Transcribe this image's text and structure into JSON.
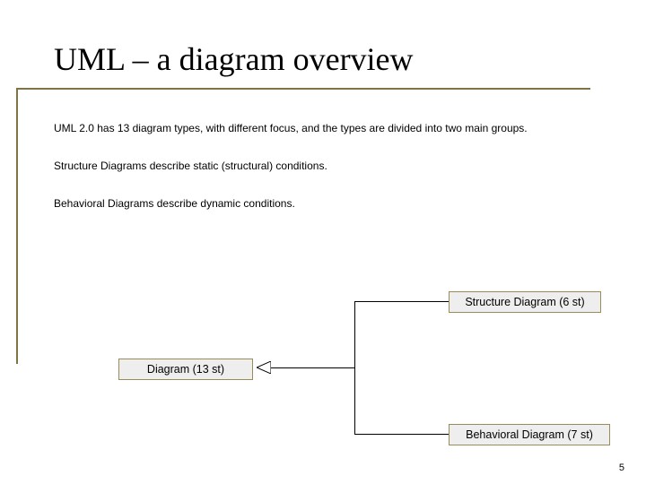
{
  "title": "UML – a diagram overview",
  "paragraphs": {
    "p1": "UML 2.0 has 13 diagram types, with different focus, and the types are divided into two main groups.",
    "p2": "Structure Diagrams describe static (structural) conditions.",
    "p3": "Behavioral Diagrams describe dynamic conditions."
  },
  "boxes": {
    "root": "Diagram (13 st)",
    "structure": "Structure Diagram (6 st)",
    "behavioral": "Behavioral Diagram (7 st)"
  },
  "page_number": "5",
  "chart_data": {
    "type": "tree",
    "root": {
      "label": "Diagram",
      "count": 13
    },
    "children": [
      {
        "label": "Structure Diagram",
        "count": 6
      },
      {
        "label": "Behavioral Diagram",
        "count": 7
      }
    ]
  }
}
